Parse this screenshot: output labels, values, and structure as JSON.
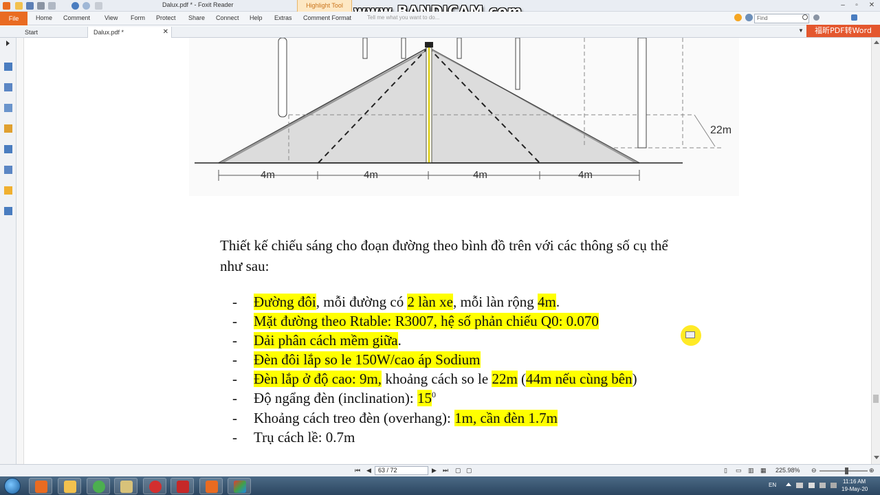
{
  "app": {
    "title": "Dalux.pdf * - Foxit Reader",
    "context_tab": "Highlight Tool",
    "watermark": "www.BANDICAM.com"
  },
  "menu": {
    "file": "File",
    "items": [
      "Home",
      "Comment",
      "View",
      "Form",
      "Protect",
      "Share",
      "Connect",
      "Help",
      "Extras",
      "Comment Format"
    ],
    "tell_me": "Tell me what you want to do...",
    "find_placeholder": "Find"
  },
  "tabs": {
    "start": "Start",
    "doc": "Dalux.pdf *"
  },
  "promo": "福昕PDF转Word",
  "diagram": {
    "height_label": "22m",
    "widths": [
      "4m",
      "4m",
      "4m",
      "4m"
    ]
  },
  "document": {
    "intro_line1": "Thiết kế chiếu sáng cho đoạn đường theo bình đồ trên với các thông số cụ thể",
    "intro_line2": "như sau:",
    "bullet": "-",
    "items": [
      {
        "parts": [
          [
            "Đường đôi",
            true
          ],
          [
            ", mỗi đường có ",
            false
          ],
          [
            "2 làn xe",
            true
          ],
          [
            ", mỗi làn rộng ",
            false
          ],
          [
            "4m",
            true
          ],
          [
            ".",
            false
          ]
        ]
      },
      {
        "parts": [
          [
            "Mặt đường theo Rtable: R3007, hệ số phản chiếu Q0: 0.070",
            true
          ]
        ]
      },
      {
        "parts": [
          [
            "Dải phân cách mềm giữa",
            true
          ],
          [
            ".",
            false
          ]
        ]
      },
      {
        "parts": [
          [
            "Đèn đôi  lắp so le 150W/cao áp Sodium",
            true
          ]
        ]
      },
      {
        "parts": [
          [
            "Đèn lắp ở độ cao: 9m,",
            true
          ],
          [
            " khoảng cách so le ",
            false
          ],
          [
            "22m",
            true
          ],
          [
            " (",
            false
          ],
          [
            "44m nếu cùng bên",
            true
          ],
          [
            ")",
            false
          ]
        ]
      },
      {
        "parts": [
          [
            "Độ ngẩng đèn (inclination): ",
            false
          ],
          [
            "15",
            true
          ]
        ],
        "sup": "0"
      },
      {
        "parts": [
          [
            "Khoảng cách treo đèn (overhang): ",
            false
          ],
          [
            "1m, cần đèn 1.7m",
            true
          ]
        ]
      },
      {
        "parts": [
          [
            "Trụ cách lề: 0.7m",
            false
          ]
        ]
      }
    ]
  },
  "status": {
    "page": "63 / 72",
    "zoom": "225.98%"
  },
  "taskbar": {
    "lang": "EN",
    "time": "11:16 AM",
    "date": "19-May-20"
  },
  "colors": {
    "highlight": "#ffff00",
    "accent_orange": "#e96b21",
    "taskbar": "#2b4560"
  }
}
